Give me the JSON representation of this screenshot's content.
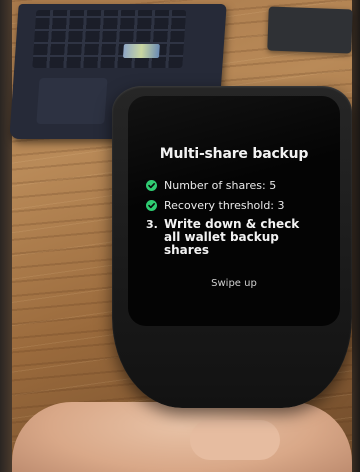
{
  "screen": {
    "title": "Multi-share backup",
    "items": [
      {
        "status": "done",
        "text": "Number of shares: 5"
      },
      {
        "status": "done",
        "text": "Recovery threshold: 3"
      }
    ],
    "step": {
      "number": "3.",
      "text": "Write down & check all wallet backup shares"
    },
    "footer_hint": "Swipe up"
  },
  "colors": {
    "check": "#2ecc71",
    "screen_bg": "#040404",
    "text": "#f2f2f2"
  }
}
